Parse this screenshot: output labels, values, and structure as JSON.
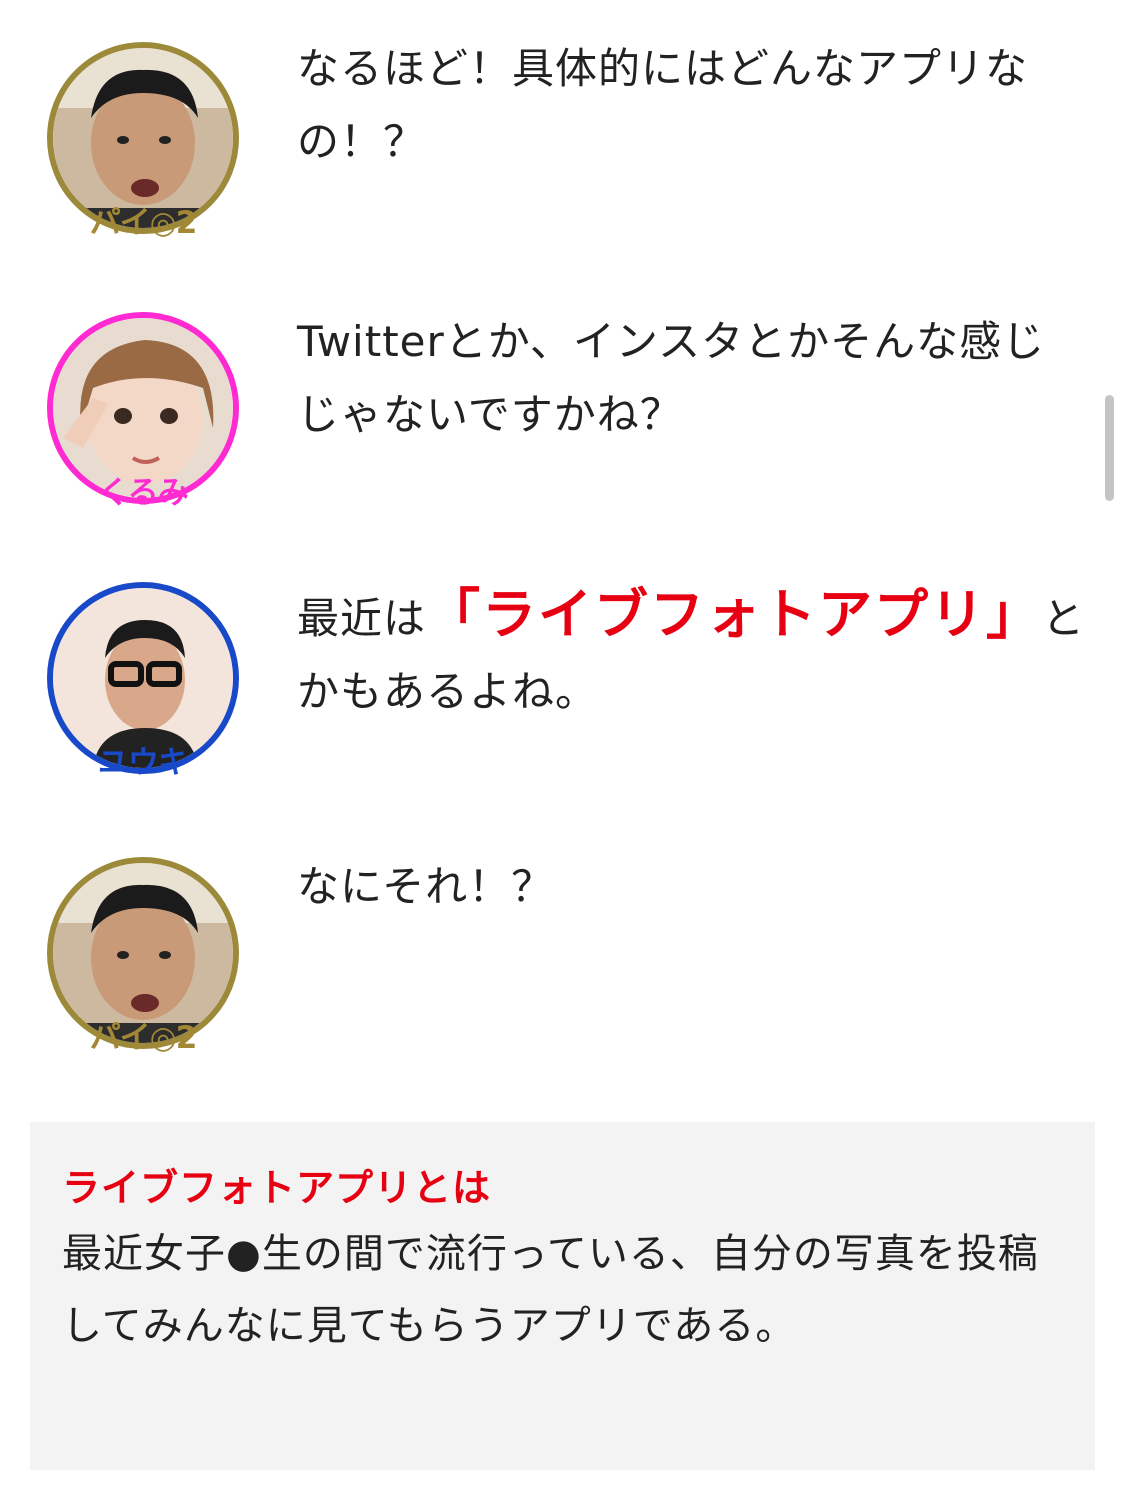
{
  "colors": {
    "highlight": "#e60012",
    "text": "#222222",
    "note_bg": "#f3f3f3",
    "border_gold": "#9c8a3a",
    "border_pink": "#ff2ad1",
    "border_blue": "#1749c8"
  },
  "messages": [
    {
      "speaker": "パイ◎2",
      "avatar_icon": "person-avatar-icon",
      "text": "なるほど！具体的にはどんなアプリなの！？"
    },
    {
      "speaker": "くるみ",
      "avatar_icon": "person-avatar-icon",
      "text": "Twitterとか、インスタとかそんな感じじゃないですかね？"
    },
    {
      "speaker": "ユウキ",
      "avatar_icon": "person-avatar-icon",
      "text_before": "最近は",
      "text_highlight": "「ライブフォトアプリ」",
      "text_after": "とかもあるよね。"
    },
    {
      "speaker": "パイ◎2",
      "avatar_icon": "person-avatar-icon",
      "text": "なにそれ！？"
    }
  ],
  "note": {
    "title": "ライブフォトアプリとは",
    "body": "最近女子●生の間で流行っている、自分の写真を投稿してみんなに見てもらうアプリである。"
  }
}
